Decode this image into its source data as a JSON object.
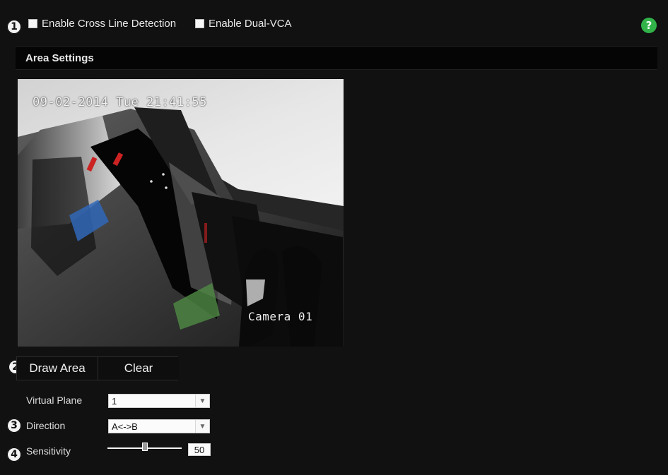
{
  "top": {
    "step1": "1",
    "checkbox1_label": "Enable Cross Line Detection",
    "checkbox2_label": "Enable Dual-VCA",
    "help_icon": "?"
  },
  "section": {
    "title": "Area Settings"
  },
  "video": {
    "timestamp": "09-02-2014 Tue 21:41:55",
    "camera_label": "Camera 01"
  },
  "controls": {
    "step2": "2",
    "draw_area": "Draw Area",
    "clear": "Clear",
    "step3": "3",
    "step4": "4",
    "virtual_plane_label": "Virtual Plane",
    "virtual_plane_value": "1",
    "direction_label": "Direction",
    "direction_value": "A<->B",
    "sensitivity_label": "Sensitivity",
    "sensitivity_value": "50"
  },
  "colors": {
    "background": "#111111",
    "help": "#31b34a"
  },
  "icons": {
    "help": "help-icon",
    "dropdown": "chevron-down-icon"
  }
}
